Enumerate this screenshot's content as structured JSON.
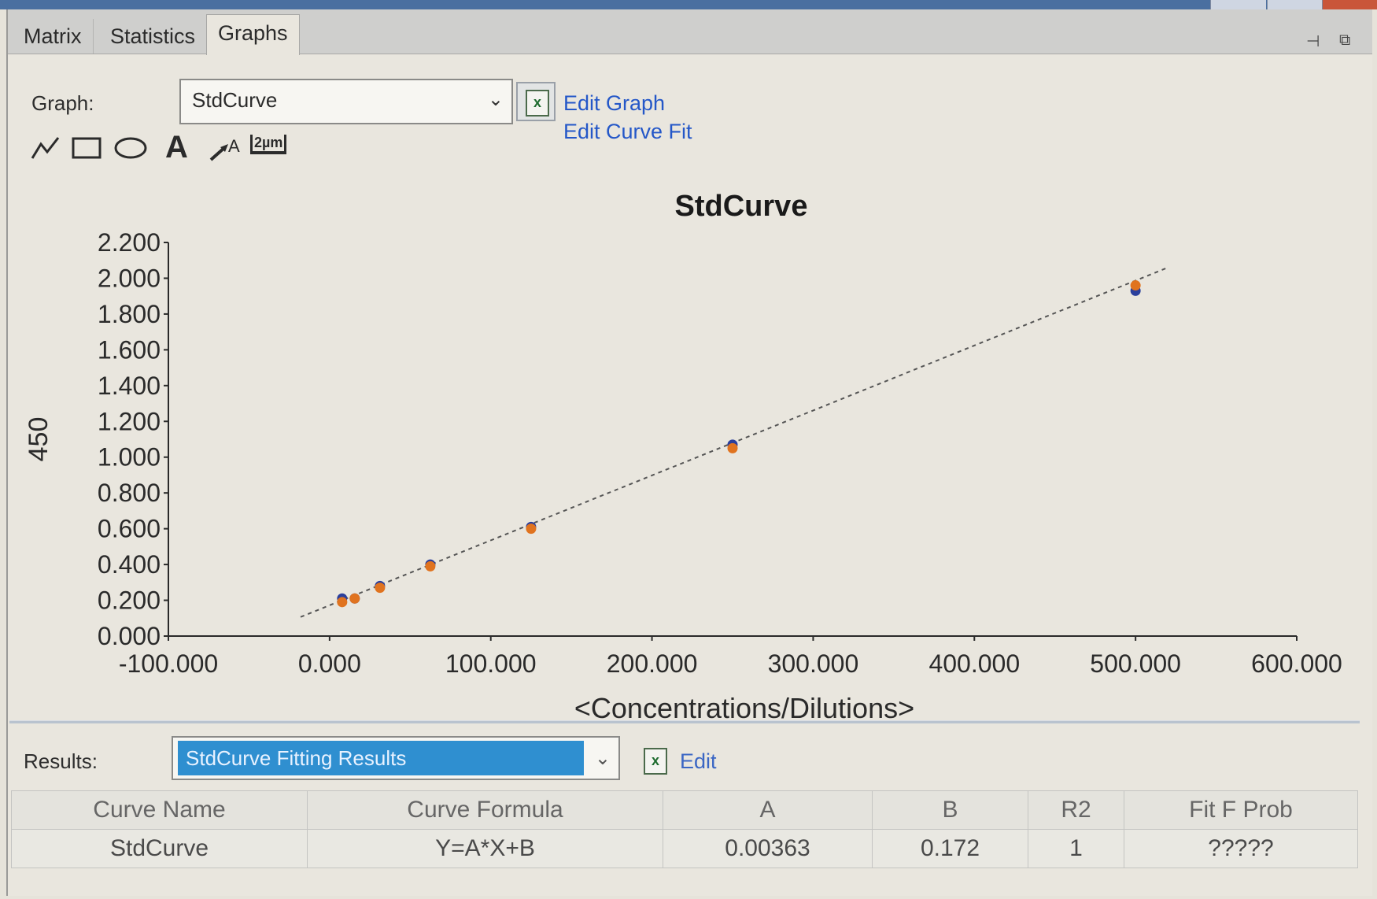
{
  "tabs": [
    {
      "label": "Matrix",
      "active": false
    },
    {
      "label": "Statistics",
      "active": false
    },
    {
      "label": "Graphs",
      "active": true
    }
  ],
  "graph_selector": {
    "label": "Graph:",
    "value": "StdCurve"
  },
  "links": {
    "edit_graph": "Edit Graph",
    "edit_curve_fit": "Edit Curve Fit",
    "edit": "Edit"
  },
  "toolbar": {
    "icons": [
      "line-draw-icon",
      "rectangle-icon",
      "ellipse-icon",
      "text-icon",
      "arrow-text-icon",
      "scale-bar-icon"
    ],
    "scale_bar_text": "2µm",
    "text_tool_glyph": "A"
  },
  "results": {
    "label": "Results:",
    "value": "StdCurve Fitting Results",
    "columns": [
      "Curve Name",
      "Curve Formula",
      "A",
      "B",
      "R2",
      "Fit F Prob"
    ],
    "rows": [
      [
        "StdCurve",
        "Y=A*X+B",
        "0.00363",
        "0.172",
        "1",
        "?????"
      ]
    ]
  },
  "chart_data": {
    "type": "scatter",
    "title": "StdCurve",
    "xlabel": "<Concentrations/Dilutions>",
    "ylabel": "450",
    "xlim": [
      -100,
      600
    ],
    "ylim": [
      0,
      2.2
    ],
    "x_ticks": [
      "-100.000",
      "0.000",
      "100.000",
      "200.000",
      "300.000",
      "400.000",
      "500.000",
      "600.000"
    ],
    "y_ticks": [
      "0.000",
      "0.200",
      "0.400",
      "0.600",
      "0.800",
      "1.000",
      "1.200",
      "1.400",
      "1.600",
      "1.800",
      "2.000",
      "2.200"
    ],
    "series": [
      {
        "color": "#2a3f9c",
        "points": [
          [
            7.8,
            0.21
          ],
          [
            15.6,
            0.21
          ],
          [
            31.25,
            0.28
          ],
          [
            62.5,
            0.4
          ],
          [
            125,
            0.61
          ],
          [
            250,
            1.07
          ],
          [
            500,
            1.93
          ]
        ]
      },
      {
        "color": "#e0731f",
        "points": [
          [
            7.8,
            0.19
          ],
          [
            15.6,
            0.21
          ],
          [
            31.25,
            0.27
          ],
          [
            62.5,
            0.39
          ],
          [
            125,
            0.6
          ],
          [
            250,
            1.05
          ],
          [
            500,
            1.96
          ]
        ]
      }
    ],
    "fit_line": {
      "slope": 0.00363,
      "intercept": 0.172,
      "x_range": [
        -18,
        520
      ],
      "style": "dashed",
      "color": "#555555"
    }
  }
}
